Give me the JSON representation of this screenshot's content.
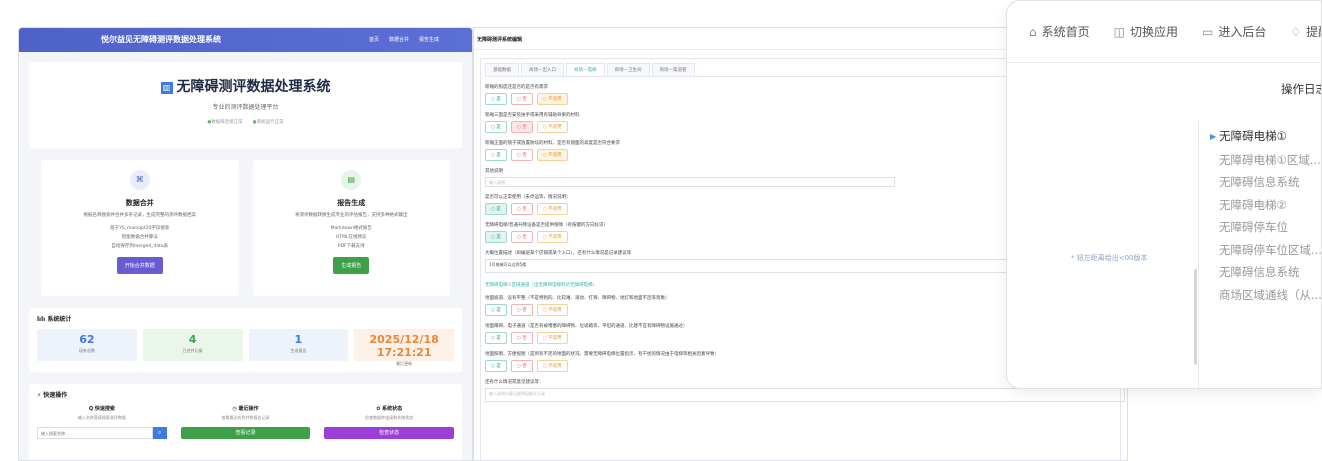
{
  "panel1": {
    "brand": "悦尔益见无障碍测评数据处理系统",
    "nav": [
      "首页",
      "数据合并",
      "报告生成"
    ],
    "hero": {
      "title": "无障碍测评数据处理系统",
      "subtitle": "专业的测评数据处理平台",
      "tags": [
        "数据库连接正常",
        "系统运行正常"
      ]
    },
    "cards": [
      {
        "title": "数据合并",
        "desc": "根据名称搜索并合并多条记录，生成完整的测评数据档案",
        "items": [
          "基于YS_mainopt20字段搜索",
          "智能数据合并算法",
          "自动保存到merged_data表"
        ],
        "button": "开始合并数据",
        "color": "#6a5bd0",
        "bg": "#e8ecfb",
        "icon": "⌘"
      },
      {
        "title": "报告生成",
        "desc": "将测评数据转换生成专业的评估报告，支持多种格式输出",
        "items": [
          "Markdown格式报告",
          "HTML在线预览",
          "PDF下载支持"
        ],
        "button": "生成报告",
        "color": "#3fa04a",
        "bg": "#e6f5e8",
        "icon": "▤"
      }
    ],
    "stats_title": "lılı 系统统计",
    "stats": [
      {
        "value": "62",
        "label": "现有总数",
        "color": "#3b7be3"
      },
      {
        "value": "4",
        "label": "已合并记录",
        "color": "#3fa04a"
      },
      {
        "value": "1",
        "label": "生成报告",
        "color": "#3b7be3"
      },
      {
        "value": "2025/12/18 17:21:21",
        "label": "最后更新",
        "color": "#e8863a"
      }
    ],
    "quick_title": "⚡ 快速操作",
    "quick": [
      {
        "title": "Q 快速搜索",
        "desc": "输入名称直接搜索测评数据",
        "placeholder": "输入搜索名称...",
        "color": "#3b7be3"
      },
      {
        "title": "◷ 最近操作",
        "desc": "查看最近的合并和报告记录",
        "button": "查看记录",
        "color": "#3fa04a"
      },
      {
        "title": "✿ 系统状态",
        "desc": "检查数据库连接和系统状态",
        "button": "检查状态",
        "color": "#9b3fd8"
      }
    ]
  },
  "panel2": {
    "heading": "无障碍测评系统编辑",
    "tabs": [
      "基础数据",
      "商场—出入口",
      "商场—电梯",
      "商场—卫生间",
      "商场—渠道管"
    ],
    "active_tab": 2,
    "opt_yes": "○ 是",
    "opt_no": "○ 否",
    "opt_na": "○ 不适用",
    "questions": [
      {
        "text": "轿厢的照度还是否的是否有需求",
        "sel": "na"
      },
      {
        "text": "轿厢三面是否安装扶手或采用有辅助效果的材料",
        "sel": "no"
      },
      {
        "text": "轿厢正面的镜子或放置防炫的材料，是否有镜面的高度是否符合要求",
        "sel": "na"
      }
    ],
    "remark_label": "其他说明",
    "remark_placeholder": "输入说明",
    "questions2": [
      {
        "text": "是否可以正常使用（未停运等，情况说明）",
        "sel": "yes"
      },
      {
        "text": "无障碍电梯/普通升降设备是否提供保障（有按键的方向标识）",
        "sel": "yes"
      }
    ],
    "big_label": "大概位置描述（如编层某个店铺或某个入口），还有什么情况是记录建议等",
    "big_value": "1号电梯可以达到5楼",
    "link_text": "无障碍电梯①区域通道（出无障碍电梯到达无障碍电梯）",
    "questions3": [
      {
        "text": "地面坡道、设有平整（不是特别的、比较难、滚动、打滑、障碍物、地灯和地面不连等现象）",
        "sel": ""
      },
      {
        "text": "地面障碍、电子通道（是否有被堵塞的障碍物、垃圾箱等、平坦的通道、比建不宜有障碍物设施通过）",
        "sel": ""
      },
      {
        "text": "地面照明、方便视图（是到有不足的地面的状况、需要无障碍电梯位置指示、有干扰的情况由于电梯等相关因素导致）",
        "sel": ""
      }
    ],
    "last_label": "还有什么情况或意见建议等：",
    "last_placeholder": "输入说明与意见或原因备注记录"
  },
  "panel3": {
    "nav": [
      {
        "icon": "⌂",
        "label": "系统首页"
      },
      {
        "icon": "◫",
        "label": "切换应用"
      },
      {
        "icon": "▭",
        "label": "进入后台"
      },
      {
        "icon": "♢",
        "label": "提醒"
      }
    ],
    "log_title": "操作日志",
    "hint": "* 钮左距离给出<00版本",
    "tree": [
      "无障碍电梯①",
      "无障碍电梯①区域...",
      "无障碍信息系统",
      "无障碍电梯②",
      "无障碍停车位",
      "无障碍停车位区域...",
      "无障碍信息系统",
      "商场区域通线（从..."
    ]
  }
}
